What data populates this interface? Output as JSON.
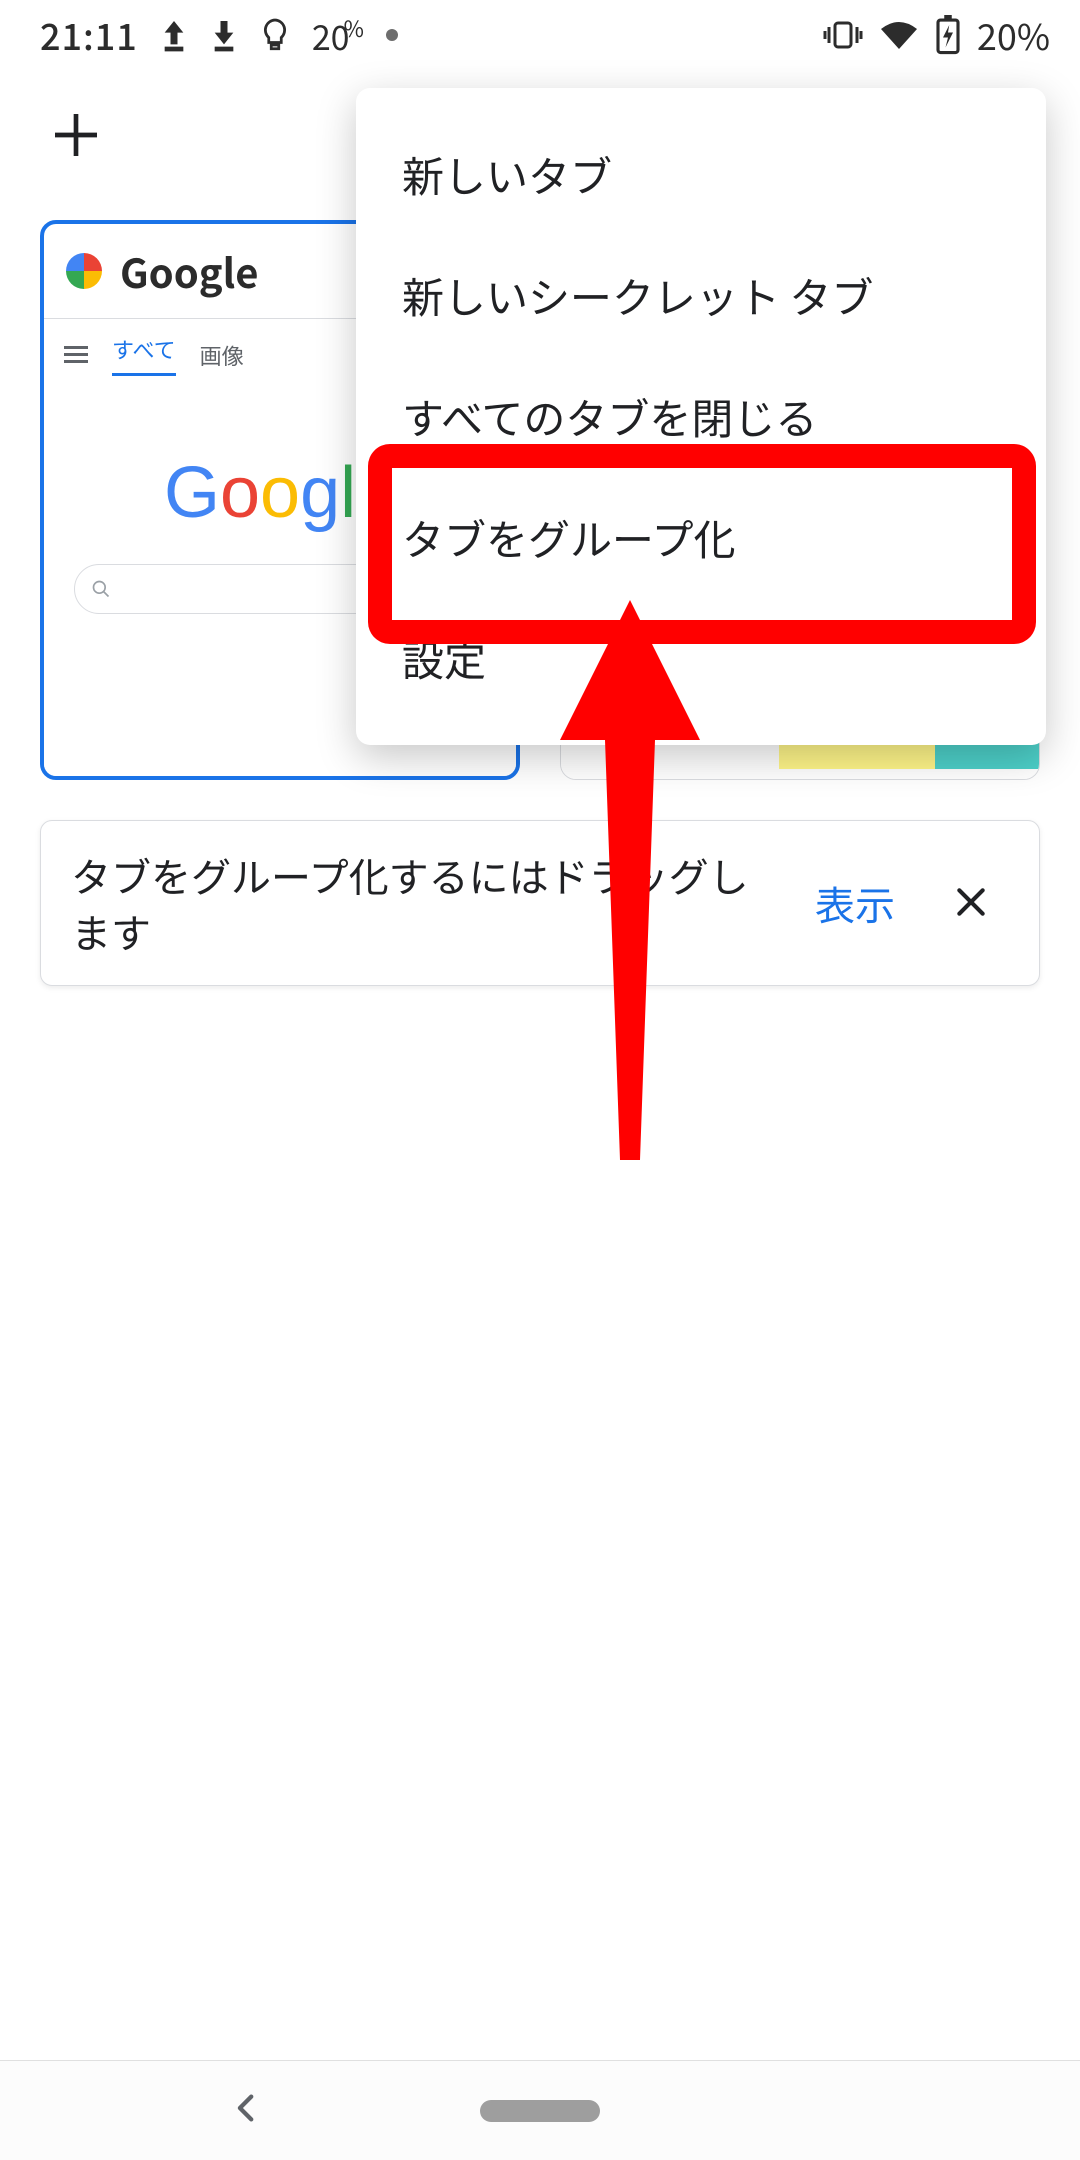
{
  "status": {
    "time": "21:11",
    "battery_small": "20",
    "battery_pct_suffix": "%",
    "battery_right": "20%"
  },
  "tabs": {
    "first": {
      "title": "Google",
      "preview_tab_all": "すべて",
      "preview_tab_image": "画像"
    }
  },
  "menu": {
    "items": [
      "新しいタブ",
      "新しいシークレット タブ",
      "すべてのタブを閉じる",
      "タブをグループ化",
      "設定"
    ]
  },
  "snackbar": {
    "text": "タブをグループ化するにはドラッグします",
    "action": "表示"
  }
}
